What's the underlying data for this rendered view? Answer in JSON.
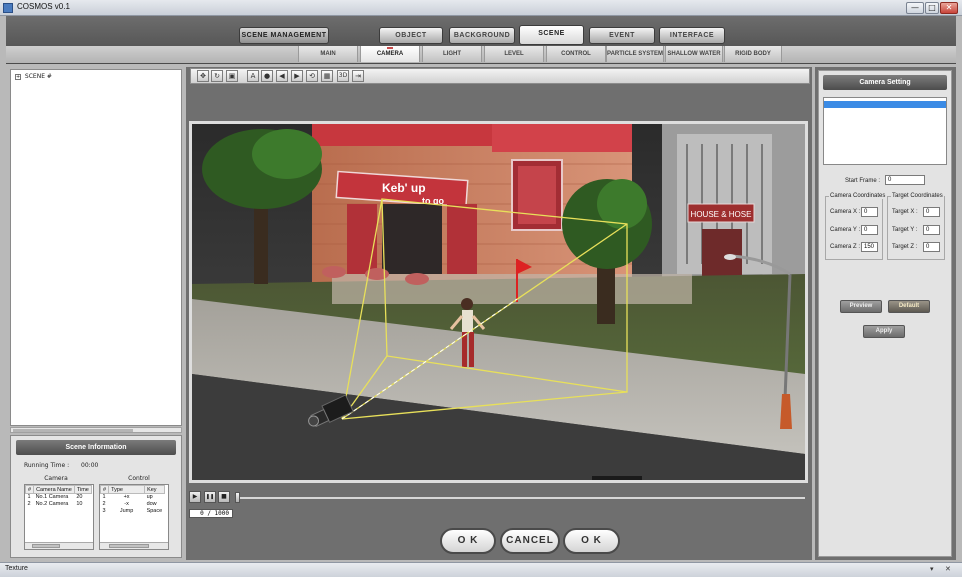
{
  "window": {
    "title": "COSMOS v0.1",
    "min": "—",
    "max": "□",
    "close": "✕"
  },
  "header": {
    "scene_management": "SCENE MANAGEMENT",
    "tabs": [
      {
        "label": "OBJECT",
        "active": false
      },
      {
        "label": "BACKGROUND",
        "active": false
      },
      {
        "label": "SCENE",
        "active": true
      },
      {
        "label": "EVENT",
        "active": false
      },
      {
        "label": "INTERFACE",
        "active": false
      }
    ],
    "subtabs": [
      {
        "label": "MAIN",
        "active": false
      },
      {
        "label": "CAMERA",
        "active": true
      },
      {
        "label": "LIGHT",
        "active": false
      },
      {
        "label": "LEVEL",
        "active": false
      },
      {
        "label": "CONTROL",
        "active": false
      },
      {
        "label": "PARTICLE SYSTEM",
        "active": false
      },
      {
        "label": "SHALLOW WATER",
        "active": false
      },
      {
        "label": "RIGID BODY",
        "active": false
      }
    ]
  },
  "tree": {
    "root": "SCENE #",
    "expand_glyph": "+"
  },
  "scene_info": {
    "title": "Scene Information",
    "running_label": "Running Time :",
    "running_value": "00:00",
    "camera_group": "Camera",
    "control_group": "Control",
    "camera_table": {
      "headers": [
        "#",
        "Camera Name",
        "Time"
      ],
      "rows": [
        [
          "1",
          "No.1 Camera",
          "20"
        ],
        [
          "2",
          "No.2 Camera",
          "10"
        ]
      ]
    },
    "control_table": {
      "headers": [
        "#",
        "Type",
        "Key"
      ],
      "rows": [
        [
          "1",
          "+x",
          "up"
        ],
        [
          "2",
          "-x",
          "dow"
        ],
        [
          "3",
          "Jump",
          "Space"
        ]
      ]
    }
  },
  "toolbar": {
    "icons": [
      {
        "name": "move-icon",
        "glyph": "✥"
      },
      {
        "name": "rotate-icon",
        "glyph": "↻"
      },
      {
        "name": "save-icon",
        "glyph": "▣"
      },
      {
        "name": "text-icon",
        "glyph": "A"
      },
      {
        "name": "record-icon",
        "glyph": "●"
      },
      {
        "name": "prev-icon",
        "glyph": "◀"
      },
      {
        "name": "next-icon",
        "glyph": "▶"
      },
      {
        "name": "loop-icon",
        "glyph": "⟲"
      },
      {
        "name": "grid-icon",
        "glyph": "▦"
      },
      {
        "name": "3d-icon",
        "glyph": "3D"
      },
      {
        "name": "export-icon",
        "glyph": "⇥"
      }
    ]
  },
  "viewport": {
    "sign_kebup": "Keb' up",
    "sign_togo": "to go",
    "sign_house": "HOUSE & HOSE"
  },
  "timeline": {
    "play_glyph": "▶",
    "pause_glyph": "❚❚",
    "stop_glyph": "■",
    "current_frame": "0",
    "total_frames": "1000",
    "counter_text": "0 /   1000",
    "progress": 0.0
  },
  "buttons": {
    "ok1": "O K",
    "cancel": "CANCEL",
    "ok2": "O K"
  },
  "camera_setting": {
    "title": "Camera Setting",
    "start_frame_label": "Start Frame :",
    "start_frame_value": "0",
    "camera_coords_title": "Camera Coordinates",
    "target_coords_title": "Target Coordinates",
    "camera_x_label": "Camera X :",
    "camera_x": "0",
    "camera_y_label": "Camera Y :",
    "camera_y": "0",
    "camera_z_label": "Camera Z :",
    "camera_z": "150",
    "target_x_label": "Target X :",
    "target_x": "0",
    "target_y_label": "Target Y :",
    "target_y": "0",
    "target_z_label": "Target Z :",
    "target_z": "0",
    "preview": "Preview",
    "default": "Default",
    "apply": "Apply"
  },
  "status": {
    "text": "Texture",
    "pin": "▾",
    "close": "✕"
  }
}
